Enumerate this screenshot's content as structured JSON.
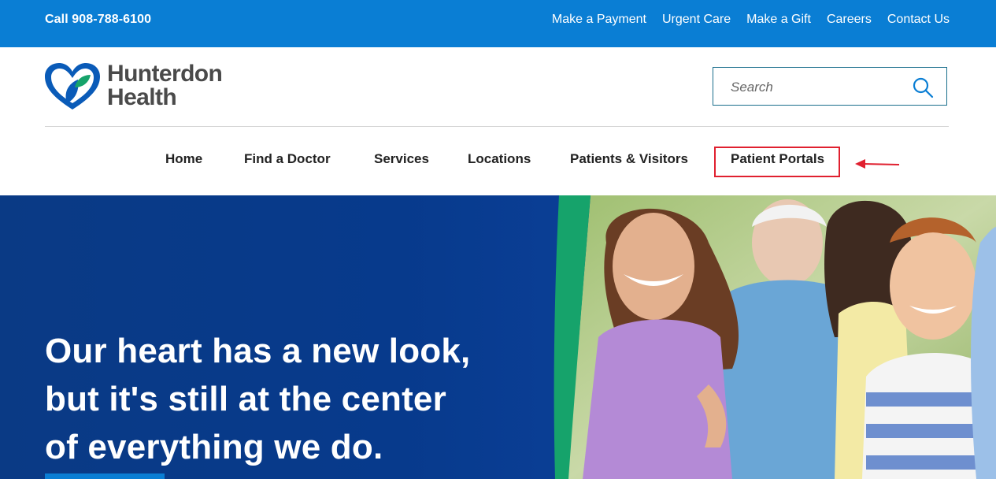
{
  "topbar": {
    "phone": "Call 908-788-6100",
    "links": [
      "Make a Payment",
      "Urgent Care",
      "Make a Gift",
      "Careers",
      "Contact Us"
    ]
  },
  "header": {
    "logo_line1": "Hunterdon",
    "logo_line2": "Health",
    "search_placeholder": "Search"
  },
  "nav": {
    "items": [
      "Home",
      "Find a Doctor",
      "Services",
      "Locations",
      "Patients & Visitors",
      "Patient Portals"
    ]
  },
  "hero": {
    "title_lines": [
      "Our heart has a new look,",
      "but it's still at the center",
      "of everything we do."
    ]
  },
  "colors": {
    "topbar": "#0a7ed4",
    "hero_bg": "#0a3a85",
    "highlight": "#e0202f",
    "accent_green": "#16a36b"
  }
}
